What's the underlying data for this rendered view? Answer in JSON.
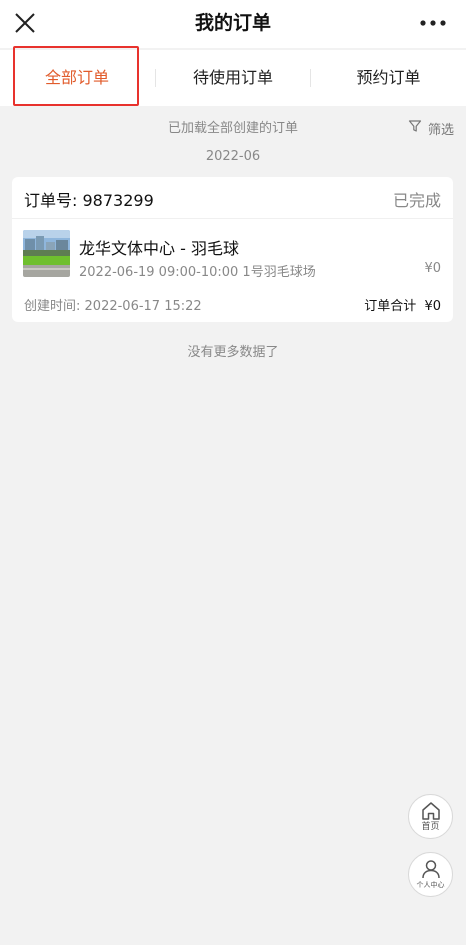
{
  "header": {
    "title": "我的订单",
    "close_icon": "close-icon",
    "more_icon": "more-icon"
  },
  "tabs": [
    {
      "label": "全部订单",
      "active": true
    },
    {
      "label": "待使用订单",
      "active": false
    },
    {
      "label": "预约订单",
      "active": false
    }
  ],
  "list": {
    "loaded_message": "已加载全部创建的订单",
    "filter_label": "筛选",
    "filter_icon": "filter-icon",
    "month": "2022-06",
    "no_more": "没有更多数据了"
  },
  "orders": [
    {
      "order_no_label": "订单号:",
      "order_no": "9873299",
      "status": "已完成",
      "venue": "龙华文体中心 - 羽毛球",
      "slot": "2022-06-19 09:00-10:00 1号羽毛球场",
      "price": "¥0",
      "created_label": "创建时间:",
      "created_time": "2022-06-17 15:22",
      "total_label": "订单合计",
      "total": "¥0"
    }
  ],
  "floating": {
    "home_label": "首页",
    "home_icon": "home-icon",
    "profile_label": "个人中心",
    "profile_icon": "user-icon"
  },
  "colors": {
    "accent": "#e15b2b",
    "highlight_box": "#e8322d",
    "background": "#f2f2f2"
  }
}
